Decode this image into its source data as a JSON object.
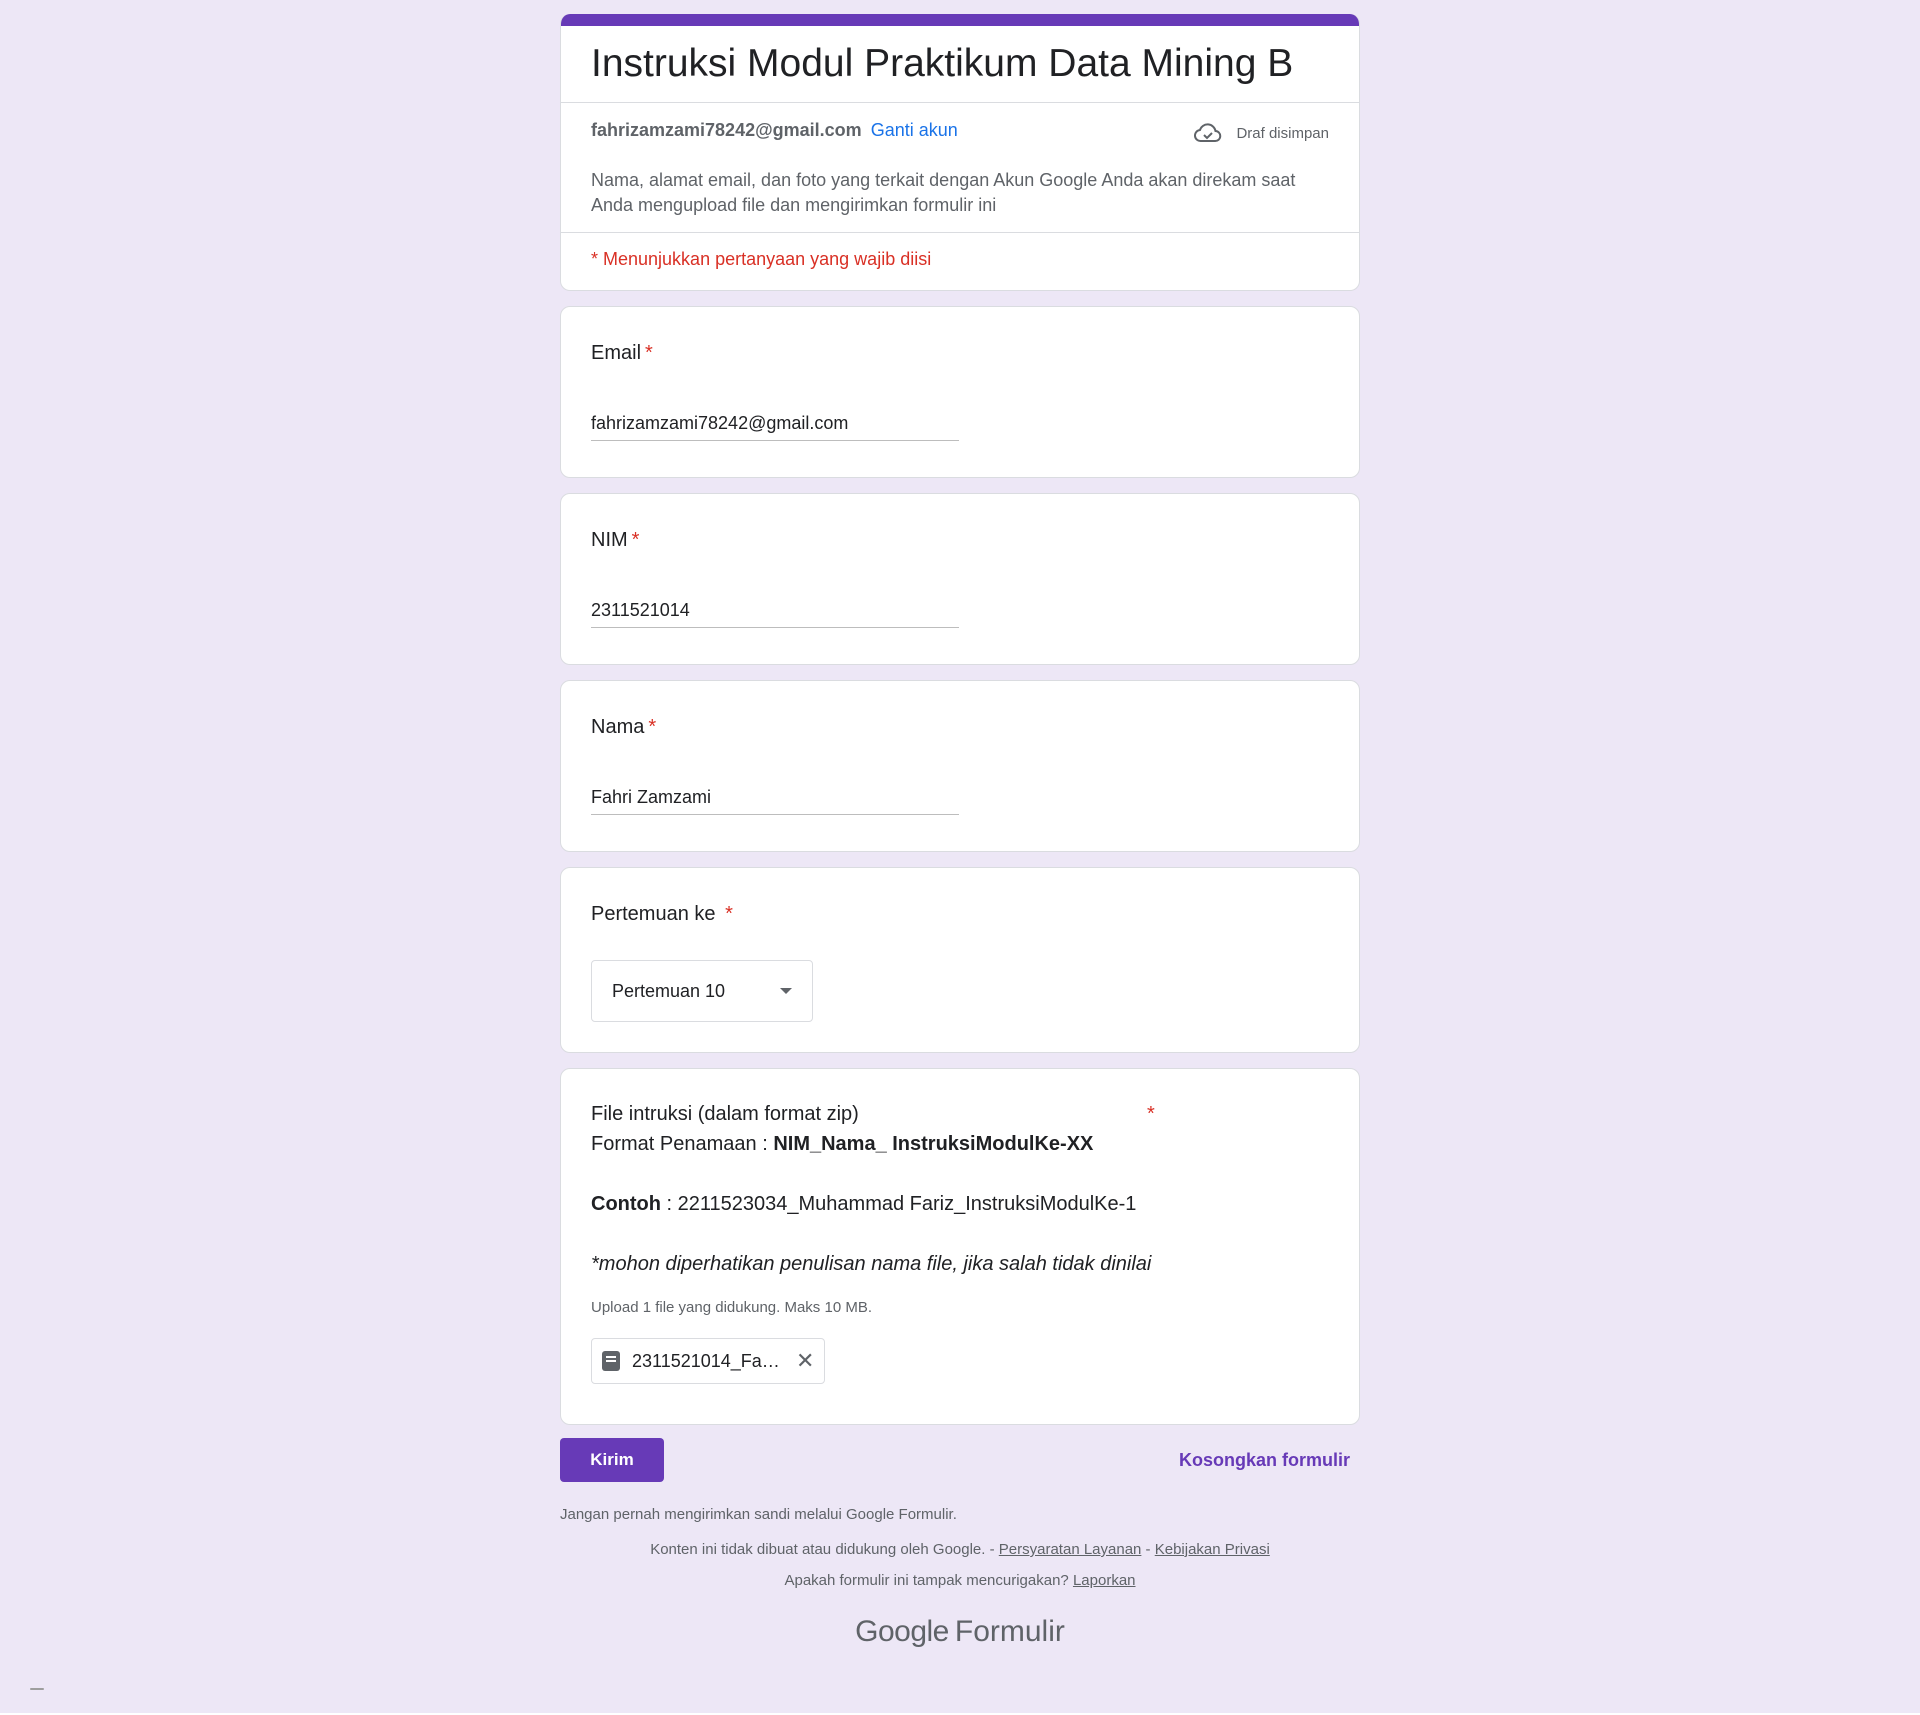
{
  "header": {
    "title": "Instruksi Modul Praktikum Data Mining B",
    "account_email": "fahrizamzami78242@gmail.com",
    "switch_account": "Ganti akun",
    "draft_status": "Draf disimpan",
    "privacy_note": "Nama, alamat email, dan foto yang terkait dengan Akun Google Anda akan direkam saat Anda mengupload file dan mengirimkan formulir ini",
    "required_note": "* Menunjukkan pertanyaan yang wajib diisi"
  },
  "questions": {
    "email": {
      "label": "Email",
      "required_mark": "*",
      "value": "fahrizamzami78242@gmail.com"
    },
    "nim": {
      "label": "NIM",
      "required_mark": "*",
      "value": "2311521014"
    },
    "nama": {
      "label": "Nama",
      "required_mark": "*",
      "value": "Fahri Zamzami"
    },
    "pertemuan": {
      "label": "Pertemuan ke ",
      "required_mark": "*",
      "selected": "Pertemuan 10"
    },
    "file": {
      "label": "File intruksi (dalam format zip)",
      "required_mark": "*",
      "format_prefix": "Format Penamaan : ",
      "format_value": "NIM_Nama_ InstruksiModulKe-XX",
      "example_label": "Contoh",
      "example_value": " : 2211523034_Muhammad Fariz_InstruksiModulKe-1",
      "note": "*mohon diperhatikan penulisan nama file, jika salah tidak dinilai",
      "upload_hint": "Upload 1 file yang didukung. Maks 10 MB.",
      "uploaded_file": "2311521014_Fah..."
    }
  },
  "actions": {
    "submit": "Kirim",
    "clear": "Kosongkan formulir"
  },
  "footer": {
    "password_warning": "Jangan pernah mengirimkan sandi melalui Google Formulir.",
    "disclaimer_prefix": "Konten ini tidak dibuat atau didukung oleh Google. - ",
    "terms": "Persyaratan Layanan",
    "separator": " - ",
    "privacy": "Kebijakan Privasi",
    "report_prefix": "Apakah formulir ini tampak mencurigakan? ",
    "report": "Laporkan",
    "brand_google": "Google",
    "brand_forms": "Formulir"
  },
  "colors": {
    "accent": "#673ab7",
    "background": "#ede7f6",
    "required": "#d93025",
    "link": "#1a73e8"
  },
  "icons": {
    "draft": "cloud-check-icon",
    "file": "document-icon",
    "remove": "close-icon",
    "dropdown": "caret-down-icon"
  }
}
